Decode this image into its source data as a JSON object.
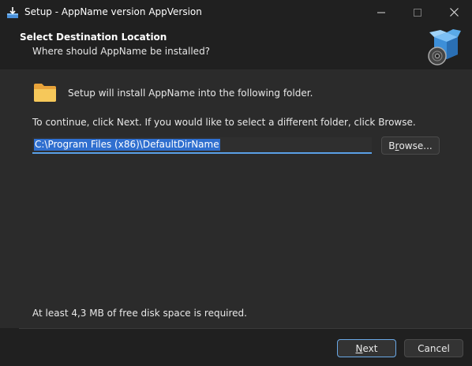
{
  "window": {
    "title": "Setup - AppName version AppVersion",
    "app_icon": "setup-installer-icon",
    "controls": [
      "minimize-icon",
      "maximize-icon",
      "close-icon"
    ]
  },
  "header": {
    "title": "Select Destination Location",
    "subtitle": "Where should AppName be installed?",
    "image": "setup-box-disc-icon"
  },
  "main": {
    "folder_icon": "folder-icon",
    "install_message": "Setup will install AppName into the following folder.",
    "continue_message": "To continue, click Next. If you would like to select a different folder, click Browse.",
    "path_value": "C:\\Program Files (x86)\\DefaultDirName",
    "browse_label_pre": "B",
    "browse_label_ul": "r",
    "browse_label_post": "owse...",
    "disk_space_message": "At least 4,3 MB of free disk space is required."
  },
  "footer": {
    "next_label_ul": "N",
    "next_label_post": "ext",
    "cancel_label": "Cancel"
  },
  "colors": {
    "background": "#202020",
    "panel": "#2b2b2b",
    "accent": "#5aa0e6",
    "selection": "#2f6fcf"
  }
}
